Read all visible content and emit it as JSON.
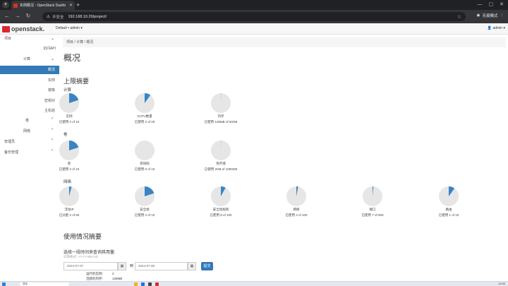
{
  "browser": {
    "tab_title": "实例概况 - OpenStack Dashb",
    "insecure_label": "不安全",
    "url": "192.168.10.20/project/",
    "incognito_label": "无痕模式"
  },
  "header": {
    "logo_text": "openstack.",
    "project_selector": "Default • admin ▾",
    "user_menu": "admin ▾"
  },
  "sidebar": {
    "project": "项目",
    "api_access": "访问API",
    "compute": "计算",
    "overview": "概况",
    "instances": "实例",
    "images": "镜像",
    "key_pairs": "密钥对",
    "server_groups": "主机组",
    "volumes": "卷",
    "network": "网络",
    "admin": "管理员",
    "backup": "备份管理"
  },
  "breadcrumb": "项目 / 计算 / 概况",
  "page_title": "概况",
  "limit_summary_title": "上限摘要",
  "groups": {
    "compute": "计算",
    "volume": "卷",
    "network": "网络"
  },
  "colors": {
    "pie_used": "#3b84c4",
    "pie_free": "#e6e6e6",
    "primary": "#337ab7"
  },
  "pies_compute": [
    {
      "label": "实例",
      "usage": "已使用 2 of 10",
      "fraction": 0.2
    },
    {
      "label": "VCPU数量",
      "usage": "已使用 2 of 20",
      "fraction": 0.1
    },
    {
      "label": "内存",
      "usage": "已使用 128MB of 50GB",
      "fraction": 0.0025
    }
  ],
  "pies_volume": [
    {
      "label": "卷",
      "usage": "已使用 2 of 10",
      "fraction": 0.2
    },
    {
      "label": "卷快照",
      "usage": "已使用 0 of 10",
      "fraction": 0.0
    },
    {
      "label": "卷存储",
      "usage": "已使用 2GB of 1000GB",
      "fraction": 0.002
    }
  ],
  "pies_network": [
    {
      "label": "浮动IP",
      "usage": "已分配 2 of 50",
      "fraction": 0.04
    },
    {
      "label": "安全组",
      "usage": "已使用 2 of 10",
      "fraction": 0.2
    },
    {
      "label": "安全组规则",
      "usage": "已使用 8 of 100",
      "fraction": 0.08
    },
    {
      "label": "网络",
      "usage": "已使用 3 of 100",
      "fraction": 0.03
    },
    {
      "label": "端口",
      "usage": "已使用 7 of 500",
      "fraction": 0.014
    },
    {
      "label": "路由",
      "usage": "已使用 1 of 10",
      "fraction": 0.1
    }
  ],
  "usage_summary_title": "使用情况摘要",
  "usage_prompt": "选择一段时间来查询其用量:",
  "date_format_hint": "日期格式: YYYY-MM-DD",
  "date_from": "2024-07-07",
  "to_label": "到",
  "date_to": "2024-07-08",
  "submit_label": "提交",
  "summary": {
    "active_instances_label": "运行的实例:",
    "active_instances_value": "2",
    "active_memory_label": "活跃的内存:",
    "active_memory_value": "128MB"
  },
  "taskbar": {
    "search_placeholder": "搜索",
    "clock": "11:50"
  }
}
